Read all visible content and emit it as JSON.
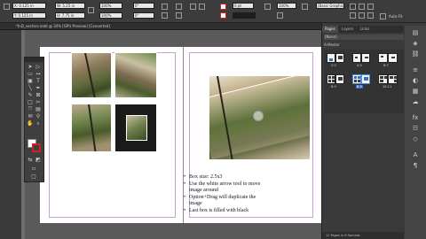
{
  "control_bar": {
    "x_value": "X: 0.125 in",
    "y_value": "Y: 0.125 in",
    "w_value": "W: 5.25 in",
    "h_value": "H: 7.75 in",
    "scale_x": "100%",
    "scale_y": "100%",
    "rotate": "0°",
    "shear": "0°",
    "stroke_weight": "0 pt",
    "opacity": "100%",
    "frame_style": "[Basic Graphics Frame]",
    "auto_fit_label": "Auto-Fit"
  },
  "document_tab": {
    "title": "*InD_vectors.indd @ 34% [GPU Preview] [Converted]"
  },
  "page_text": {
    "bullets": [
      "Box size: 2.5x3",
      "Use the white arrow tool to move image around",
      "Option+Drag will duplicate the image",
      "Last box is filled with black"
    ]
  },
  "panel": {
    "tabs": [
      "Pages",
      "Layers",
      "Links"
    ],
    "none_label": "[None]",
    "master_label": "A-Master",
    "spreads": [
      {
        "label": "2-3",
        "selected": false
      },
      {
        "label": "4-5",
        "selected": false
      },
      {
        "label": "6-7",
        "selected": false
      },
      {
        "label": "8-9",
        "selected": false
      },
      {
        "label": "8-9",
        "selected": true
      },
      {
        "label": "10-11",
        "selected": false
      }
    ],
    "status": "12 Pages in 6 Spreads"
  },
  "colors": {
    "accent": "#3a6fc8",
    "stroke_none": "#cc2222",
    "guide": "#c9a0d6"
  },
  "icons": {
    "toolbox": [
      "selection-tool-icon",
      "direct-selection-tool-icon",
      "page-tool-icon",
      "gap-tool-icon",
      "content-collector-icon",
      "type-tool-icon",
      "line-tool-icon",
      "pen-tool-icon",
      "pencil-tool-icon",
      "rectangle-frame-tool-icon",
      "rectangle-tool-icon",
      "scissors-tool-icon",
      "free-transform-tool-icon",
      "gradient-swatch-tool-icon",
      "note-tool-icon",
      "eyedropper-tool-icon",
      "hand-tool-icon",
      "zoom-tool-icon"
    ],
    "side_panel": [
      "pages-panel-icon",
      "layers-panel-icon",
      "links-panel-icon",
      "stroke-panel-icon",
      "color-panel-icon",
      "swatches-panel-icon",
      "cc-libraries-icon",
      "effects-panel-icon",
      "text-wrap-icon",
      "object-styles-icon",
      "character-styles-icon",
      "paragraph-styles-icon"
    ]
  }
}
